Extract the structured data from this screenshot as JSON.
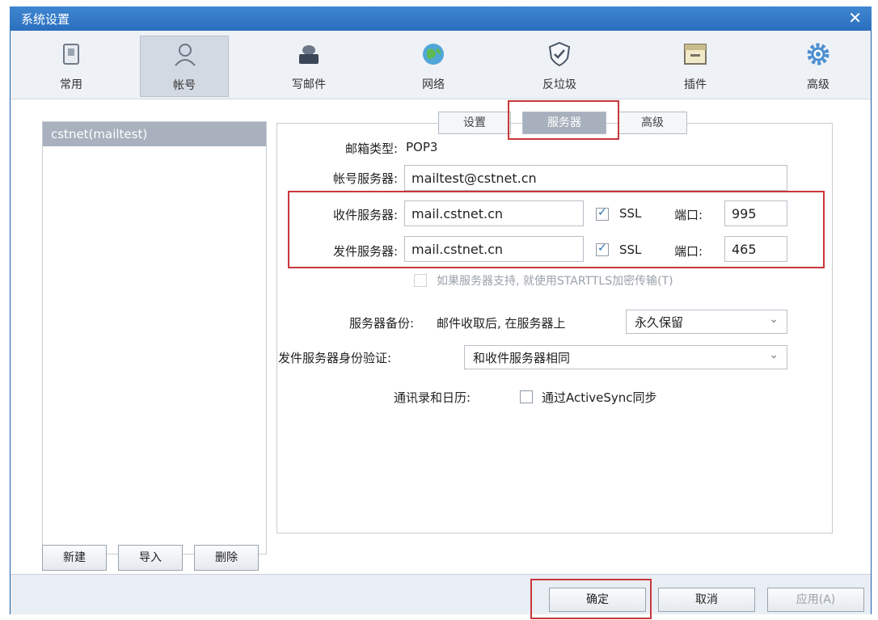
{
  "window": {
    "title": "系统设置",
    "close_glyph": "✕"
  },
  "toolbar": [
    {
      "label": "常用",
      "icon": "general-icon"
    },
    {
      "label": "帐号",
      "icon": "account-icon"
    },
    {
      "label": "写邮件",
      "icon": "compose-icon"
    },
    {
      "label": "网络",
      "icon": "network-icon"
    },
    {
      "label": "反垃圾",
      "icon": "antispam-icon"
    },
    {
      "label": "插件",
      "icon": "plugin-icon"
    },
    {
      "label": "高级",
      "icon": "advanced-icon"
    }
  ],
  "accounts": {
    "items": [
      "cstnet(mailtest)"
    ],
    "new_button": "新建",
    "import_button": "导入",
    "delete_button": "删除"
  },
  "tabs": [
    "设置",
    "服务器",
    "高级"
  ],
  "server": {
    "mailbox_type_label": "邮箱类型:",
    "mailbox_type_value": "POP3",
    "account_server_label": "帐号服务器:",
    "account_server_value": "mailtest@cstnet.cn",
    "incoming_label": "收件服务器:",
    "incoming_value": "mail.cstnet.cn",
    "incoming_ssl": "SSL",
    "incoming_port_label": "端口:",
    "incoming_port": "995",
    "outgoing_label": "发件服务器:",
    "outgoing_value": "mail.cstnet.cn",
    "outgoing_ssl": "SSL",
    "outgoing_port_label": "端口:",
    "outgoing_port": "465",
    "starttls_text": "如果服务器支持, 就使用STARTTLS加密传输(T)",
    "backup_label": "服务器备份:",
    "backup_prefix": "邮件收取后, 在服务器上",
    "backup_value": "永久保留",
    "auth_label": "发件服务器身份验证:",
    "auth_value": "和收件服务器相同",
    "contacts_label": "通讯录和日历:",
    "activesync_text": "通过ActiveSync同步"
  },
  "footer": {
    "ok": "确定",
    "cancel": "取消",
    "apply": "应用(A)"
  },
  "colors": {
    "title_bar": "#2a6fbe",
    "highlight_box": "#c9373b",
    "active_tab": "#a7b0bc"
  }
}
